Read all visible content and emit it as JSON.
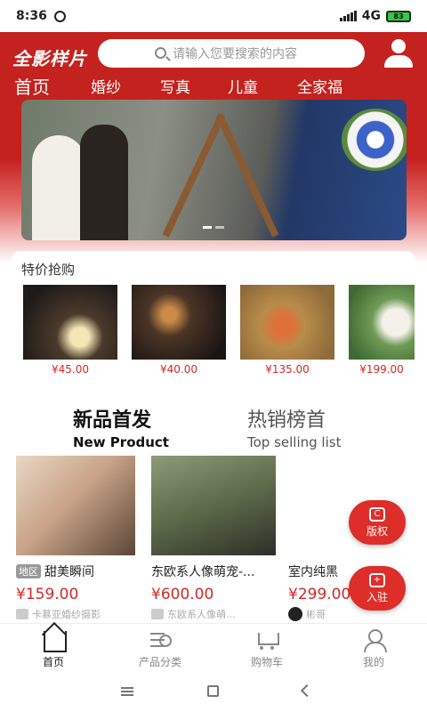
{
  "status_bar": {
    "time": "8:36",
    "network": "4G",
    "battery": "83"
  },
  "header": {
    "logo": "全影样片",
    "search_placeholder": "请输入您要搜索的内容",
    "categories": [
      "首页",
      "婚纱",
      "写真",
      "儿童",
      "全家福"
    ]
  },
  "deals": {
    "title": "特价抢购",
    "items": [
      {
        "price": "¥45.00"
      },
      {
        "price": "¥40.00"
      },
      {
        "price": "¥135.00"
      },
      {
        "price": "¥199.00"
      }
    ]
  },
  "sections": {
    "new_zh": "新品首发",
    "new_en": "New Product",
    "top_zh": "热销榜首",
    "top_en": "Top selling list"
  },
  "products": [
    {
      "tag": "地区",
      "name": "甜美瞬间",
      "price": "¥159.00",
      "shop": "卡慕亚婚纱摄影"
    },
    {
      "name": "东欧系人像萌宠-...",
      "price": "¥600.00",
      "shop": "东欧系人像萌..."
    },
    {
      "name": "室内纯黑",
      "price": "¥299.00",
      "shop": "彬哥"
    }
  ],
  "floating": {
    "copyright": "版权",
    "join": "入驻"
  },
  "tabbar": [
    "首页",
    "产品分类",
    "购物车",
    "我的"
  ],
  "colors": {
    "brand_red": "#c4221f",
    "price_red": "#d22a26"
  }
}
